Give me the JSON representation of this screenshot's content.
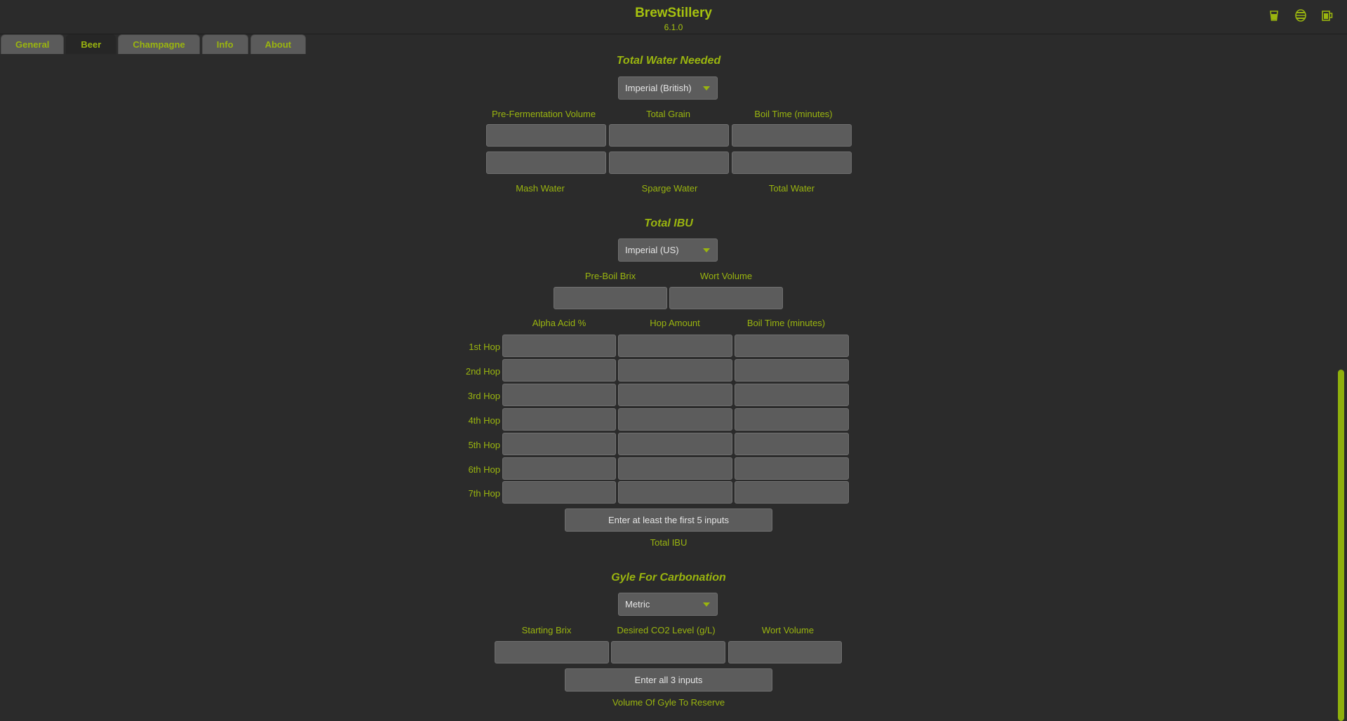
{
  "app": {
    "title": "BrewStillery",
    "version": "6.1.0"
  },
  "header_icons": [
    "beer-glass-icon",
    "barrel-icon",
    "beer-mug-icon"
  ],
  "tabs": [
    {
      "label": "General",
      "active": false
    },
    {
      "label": "Beer",
      "active": true
    },
    {
      "label": "Champagne",
      "active": false
    },
    {
      "label": "Info",
      "active": false
    },
    {
      "label": "About",
      "active": false
    }
  ],
  "water": {
    "title": "Total Water Needed",
    "unit": "Imperial (British)",
    "labels": {
      "pre_ferm": "Pre-Fermentation Volume",
      "total_grain": "Total Grain",
      "boil_time": "Boil Time (minutes)"
    },
    "out_labels": {
      "mash": "Mash Water",
      "sparge": "Sparge Water",
      "total": "Total Water"
    }
  },
  "ibu": {
    "title": "Total IBU",
    "unit": "Imperial (US)",
    "labels": {
      "brix": "Pre-Boil Brix",
      "wort": "Wort Volume",
      "alpha": "Alpha Acid %",
      "amount": "Hop Amount",
      "boil": "Boil Time (minutes)"
    },
    "hops": [
      "1st Hop",
      "2nd Hop",
      "3rd Hop",
      "4th Hop",
      "5th Hop",
      "6th Hop",
      "7th Hop"
    ],
    "button": "Enter at least the first 5 inputs",
    "result": "Total IBU"
  },
  "gyle": {
    "title": "Gyle For Carbonation",
    "unit": "Metric",
    "labels": {
      "brix": "Starting Brix",
      "co2": "Desired CO2 Level (g/L)",
      "wort": "Wort Volume"
    },
    "button": "Enter all 3 inputs",
    "result": "Volume Of Gyle To Reserve"
  },
  "colors": {
    "accent": "#9ab50f",
    "background": "#2b2b2b",
    "field": "#5c5c5c"
  }
}
